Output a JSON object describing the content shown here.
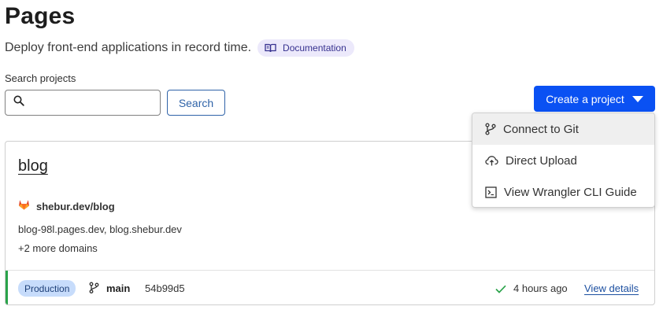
{
  "header": {
    "title": "Pages",
    "subtitle": "Deploy front-end applications in record time.",
    "doc_badge_label": "Documentation",
    "doc_badge_icon": "book-icon"
  },
  "search": {
    "label": "Search projects",
    "value": "",
    "placeholder": "",
    "button_label": "Search",
    "icon": "search-icon"
  },
  "create_project": {
    "label": "Create a project",
    "icon": "caret-down-icon",
    "menu": [
      {
        "label": "Connect to Git",
        "icon": "git-branch-icon",
        "active": true
      },
      {
        "label": "Direct Upload",
        "icon": "cloud-upload-icon",
        "active": false
      },
      {
        "label": "View Wrangler CLI Guide",
        "icon": "terminal-icon",
        "active": false
      }
    ]
  },
  "project": {
    "name": "blog",
    "repo": "shebur.dev/blog",
    "repo_icon": "gitlab-icon",
    "domains": "blog-98l.pages.dev, blog.shebur.dev",
    "more_domains": "+2 more domains",
    "deployment": {
      "environment": "Production",
      "branch": "main",
      "commit": "54b99d5",
      "time": "4 hours ago",
      "status_icon": "check-icon",
      "view_details_label": "View details"
    }
  },
  "colors": {
    "primary": "#0a51f3",
    "accent_purple_bg": "#ece9fb",
    "production_badge_bg": "#c7dcfb",
    "success": "#2aa34a",
    "link": "#1c4fa0"
  }
}
